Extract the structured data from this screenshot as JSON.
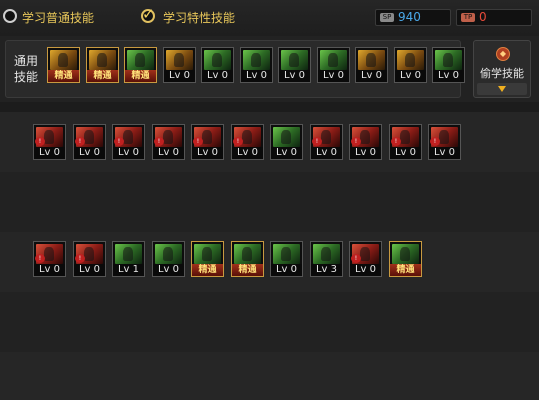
{
  "tabs": [
    {
      "label": "学习普通技能",
      "checked": false
    },
    {
      "label": "学习特性技能",
      "checked": true
    }
  ],
  "currencies": [
    {
      "icon": "skill-point-icon",
      "value": "940",
      "color": "#4aa8e8"
    },
    {
      "icon": "special-point-icon",
      "value": "0",
      "color": "#e84a3a"
    }
  ],
  "general_label": "通用技能",
  "steal_button": {
    "label": "偷学技能"
  },
  "rows": [
    {
      "name": "general",
      "skills": [
        {
          "level": "精通",
          "master": true,
          "color": "gold"
        },
        {
          "level": "精通",
          "master": true,
          "color": "gold"
        },
        {
          "level": "精通",
          "master": true,
          "color": "green"
        },
        {
          "level": "Lv 0",
          "master": false,
          "color": "gold"
        },
        {
          "level": "Lv 0",
          "master": false,
          "color": "green"
        },
        {
          "level": "Lv 0",
          "master": false,
          "color": "green"
        },
        {
          "level": "Lv 0",
          "master": false,
          "color": "green"
        },
        {
          "level": "Lv 0",
          "master": false,
          "color": "green"
        },
        {
          "level": "Lv 0",
          "master": false,
          "color": "gold"
        },
        {
          "level": "Lv 0",
          "master": false,
          "color": "gold"
        },
        {
          "level": "Lv 0",
          "master": false,
          "color": "green"
        }
      ]
    },
    {
      "name": "row-2",
      "skills": [
        {
          "level": "Lv 0",
          "master": false,
          "color": "red",
          "locked": true
        },
        {
          "level": "Lv 0",
          "master": false,
          "color": "red",
          "locked": true
        },
        {
          "level": "Lv 0",
          "master": false,
          "color": "red",
          "locked": true
        },
        {
          "level": "Lv 0",
          "master": false,
          "color": "red",
          "locked": true
        },
        {
          "level": "Lv 0",
          "master": false,
          "color": "red",
          "locked": true
        },
        {
          "level": "Lv 0",
          "master": false,
          "color": "red",
          "locked": true
        },
        {
          "level": "Lv 0",
          "master": false,
          "color": "green",
          "locked": false
        },
        {
          "level": "Lv 0",
          "master": false,
          "color": "red",
          "locked": true
        },
        {
          "level": "Lv 0",
          "master": false,
          "color": "red",
          "locked": true
        },
        {
          "level": "Lv 0",
          "master": false,
          "color": "red",
          "locked": true
        },
        {
          "level": "Lv 0",
          "master": false,
          "color": "red",
          "locked": true
        }
      ]
    },
    {
      "name": "row-3",
      "skills": [
        {
          "level": "Lv 0",
          "master": false,
          "color": "red",
          "locked": true
        },
        {
          "level": "Lv 0",
          "master": false,
          "color": "red",
          "locked": true
        },
        {
          "level": "Lv 1",
          "master": false,
          "color": "green",
          "locked": false
        },
        {
          "level": "Lv 0",
          "master": false,
          "color": "green",
          "locked": false
        },
        {
          "level": "精通",
          "master": true,
          "color": "green",
          "locked": false
        },
        {
          "level": "精通",
          "master": true,
          "color": "green",
          "locked": false
        },
        {
          "level": "Lv 0",
          "master": false,
          "color": "green",
          "locked": false
        },
        {
          "level": "Lv 3",
          "master": false,
          "color": "green",
          "locked": false
        },
        {
          "level": "Lv 0",
          "master": false,
          "color": "red",
          "locked": true
        },
        {
          "level": "精通",
          "master": true,
          "color": "green",
          "locked": false
        }
      ]
    }
  ]
}
